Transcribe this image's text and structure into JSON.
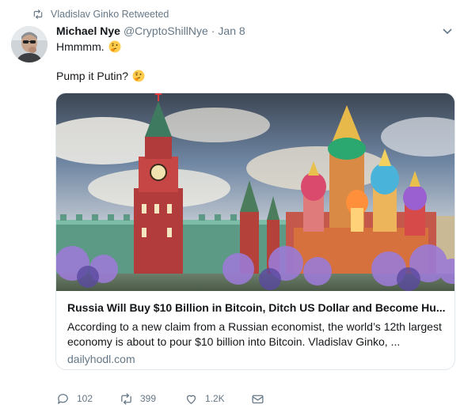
{
  "retweet_banner": {
    "text": "Vladislav Ginko Retweeted",
    "icon": "retweet-icon"
  },
  "tweet": {
    "author_name": "Michael Nye",
    "handle": "@CryptoShillNye",
    "separator": "·",
    "date": "Jan 8",
    "text_line1": "Hmmmm.",
    "text_line1_emoji": "thinking-face-emoji",
    "text_line2": "Pump it Putin?",
    "text_line2_emoji": "thinking-face-emoji"
  },
  "card": {
    "image_subject": "St. Basil's Cathedral and the Kremlin tower",
    "title": "Russia Will Buy $10 Billion in Bitcoin, Ditch US Dollar and Become Hu...",
    "description": "According to a new claim from a Russian economist, the world’s 12th largest economy is about to pour $10 billion into Bitcoin. Vladislav Ginko, ...",
    "domain": "dailyhodl.com"
  },
  "actions": {
    "replies": "102",
    "retweets": "399",
    "likes": "1.2K"
  },
  "colors": {
    "text": "#14171a",
    "muted": "#657786",
    "border": "#e1e8ed"
  }
}
